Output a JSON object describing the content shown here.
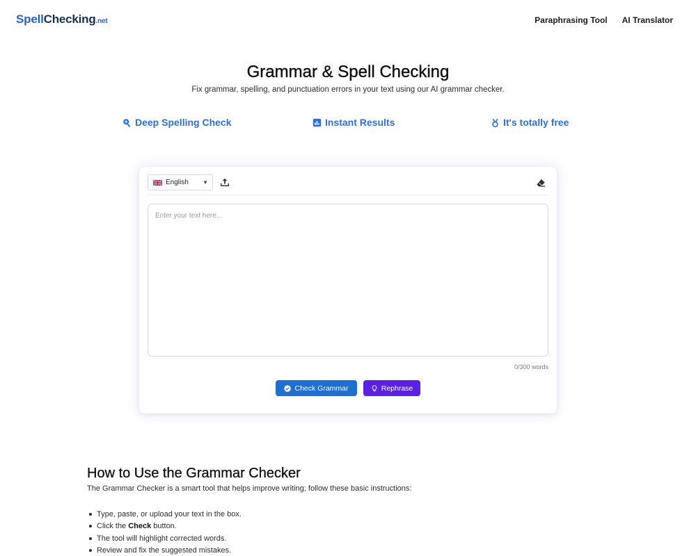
{
  "header": {
    "logo": {
      "part1": "Spell",
      "part2": "Checking",
      "part3": ".net"
    },
    "nav": [
      "Paraphrasing Tool",
      "AI Translator"
    ]
  },
  "hero": {
    "title": "Grammar & Spell Checking",
    "subtitle": "Fix grammar, spelling, and punctuation errors in your text using our AI grammar checker."
  },
  "features": [
    {
      "icon": "search-zoom-icon",
      "label": "Deep Spelling Check"
    },
    {
      "icon": "bar-chart-icon",
      "label": "Instant Results"
    },
    {
      "icon": "medal-icon",
      "label": "It's totally free"
    }
  ],
  "editor": {
    "language": "English",
    "placeholder": "Enter your text here...",
    "word_count": "0/300 words",
    "check_label": "Check Grammar",
    "rephrase_label": "Rephrase"
  },
  "how_to": {
    "title": "How to Use the Grammar Checker",
    "description": "The Grammar Checker is a smart tool that helps improve writing; follow these basic instructions:",
    "steps": [
      {
        "text": "Type, paste, or upload your text in the box."
      },
      {
        "before": "Click the",
        "bold": "Check",
        "after": "button."
      },
      {
        "text": "The tool will highlight corrected words."
      },
      {
        "text": "Review and fix the suggested mistakes."
      }
    ]
  },
  "colors": {
    "brand_blue": "#2563c9",
    "feature_blue": "#2f6fd6",
    "check_button": "#1f6fd0",
    "rephrase_button": "#5a22e0"
  }
}
